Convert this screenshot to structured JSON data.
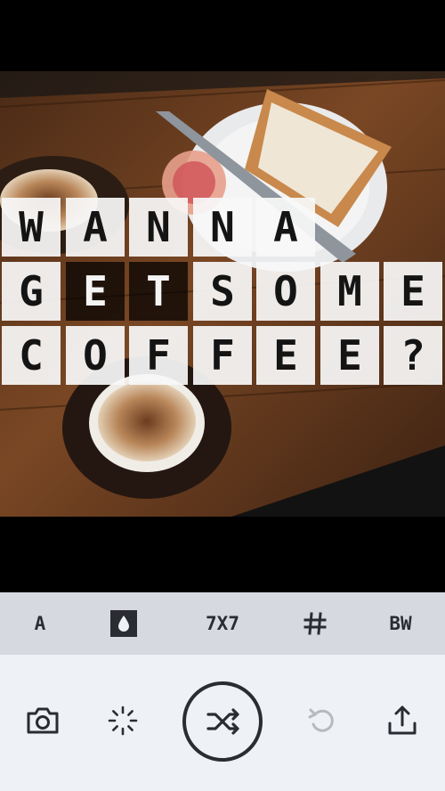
{
  "overlay": {
    "rows": [
      [
        "W",
        "A",
        "N",
        "N",
        "A"
      ],
      [
        "G",
        "E",
        "T",
        "S",
        "O",
        "M",
        "E"
      ],
      [
        "C",
        "O",
        "F",
        "F",
        "E",
        "E",
        "?"
      ]
    ]
  },
  "toolbar": {
    "font_label": "A",
    "grid_size_label": "7X7",
    "bw_label": "BW"
  },
  "actions": [
    "camera-icon",
    "brightness-icon",
    "shuffle-icon",
    "undo-icon",
    "share-icon"
  ],
  "colors": {
    "toolbar_bg": "#d6d9e0",
    "bottom_bg": "#eef1f6",
    "icon": "#2a2c31",
    "disabled_icon": "#b7b9bf"
  }
}
